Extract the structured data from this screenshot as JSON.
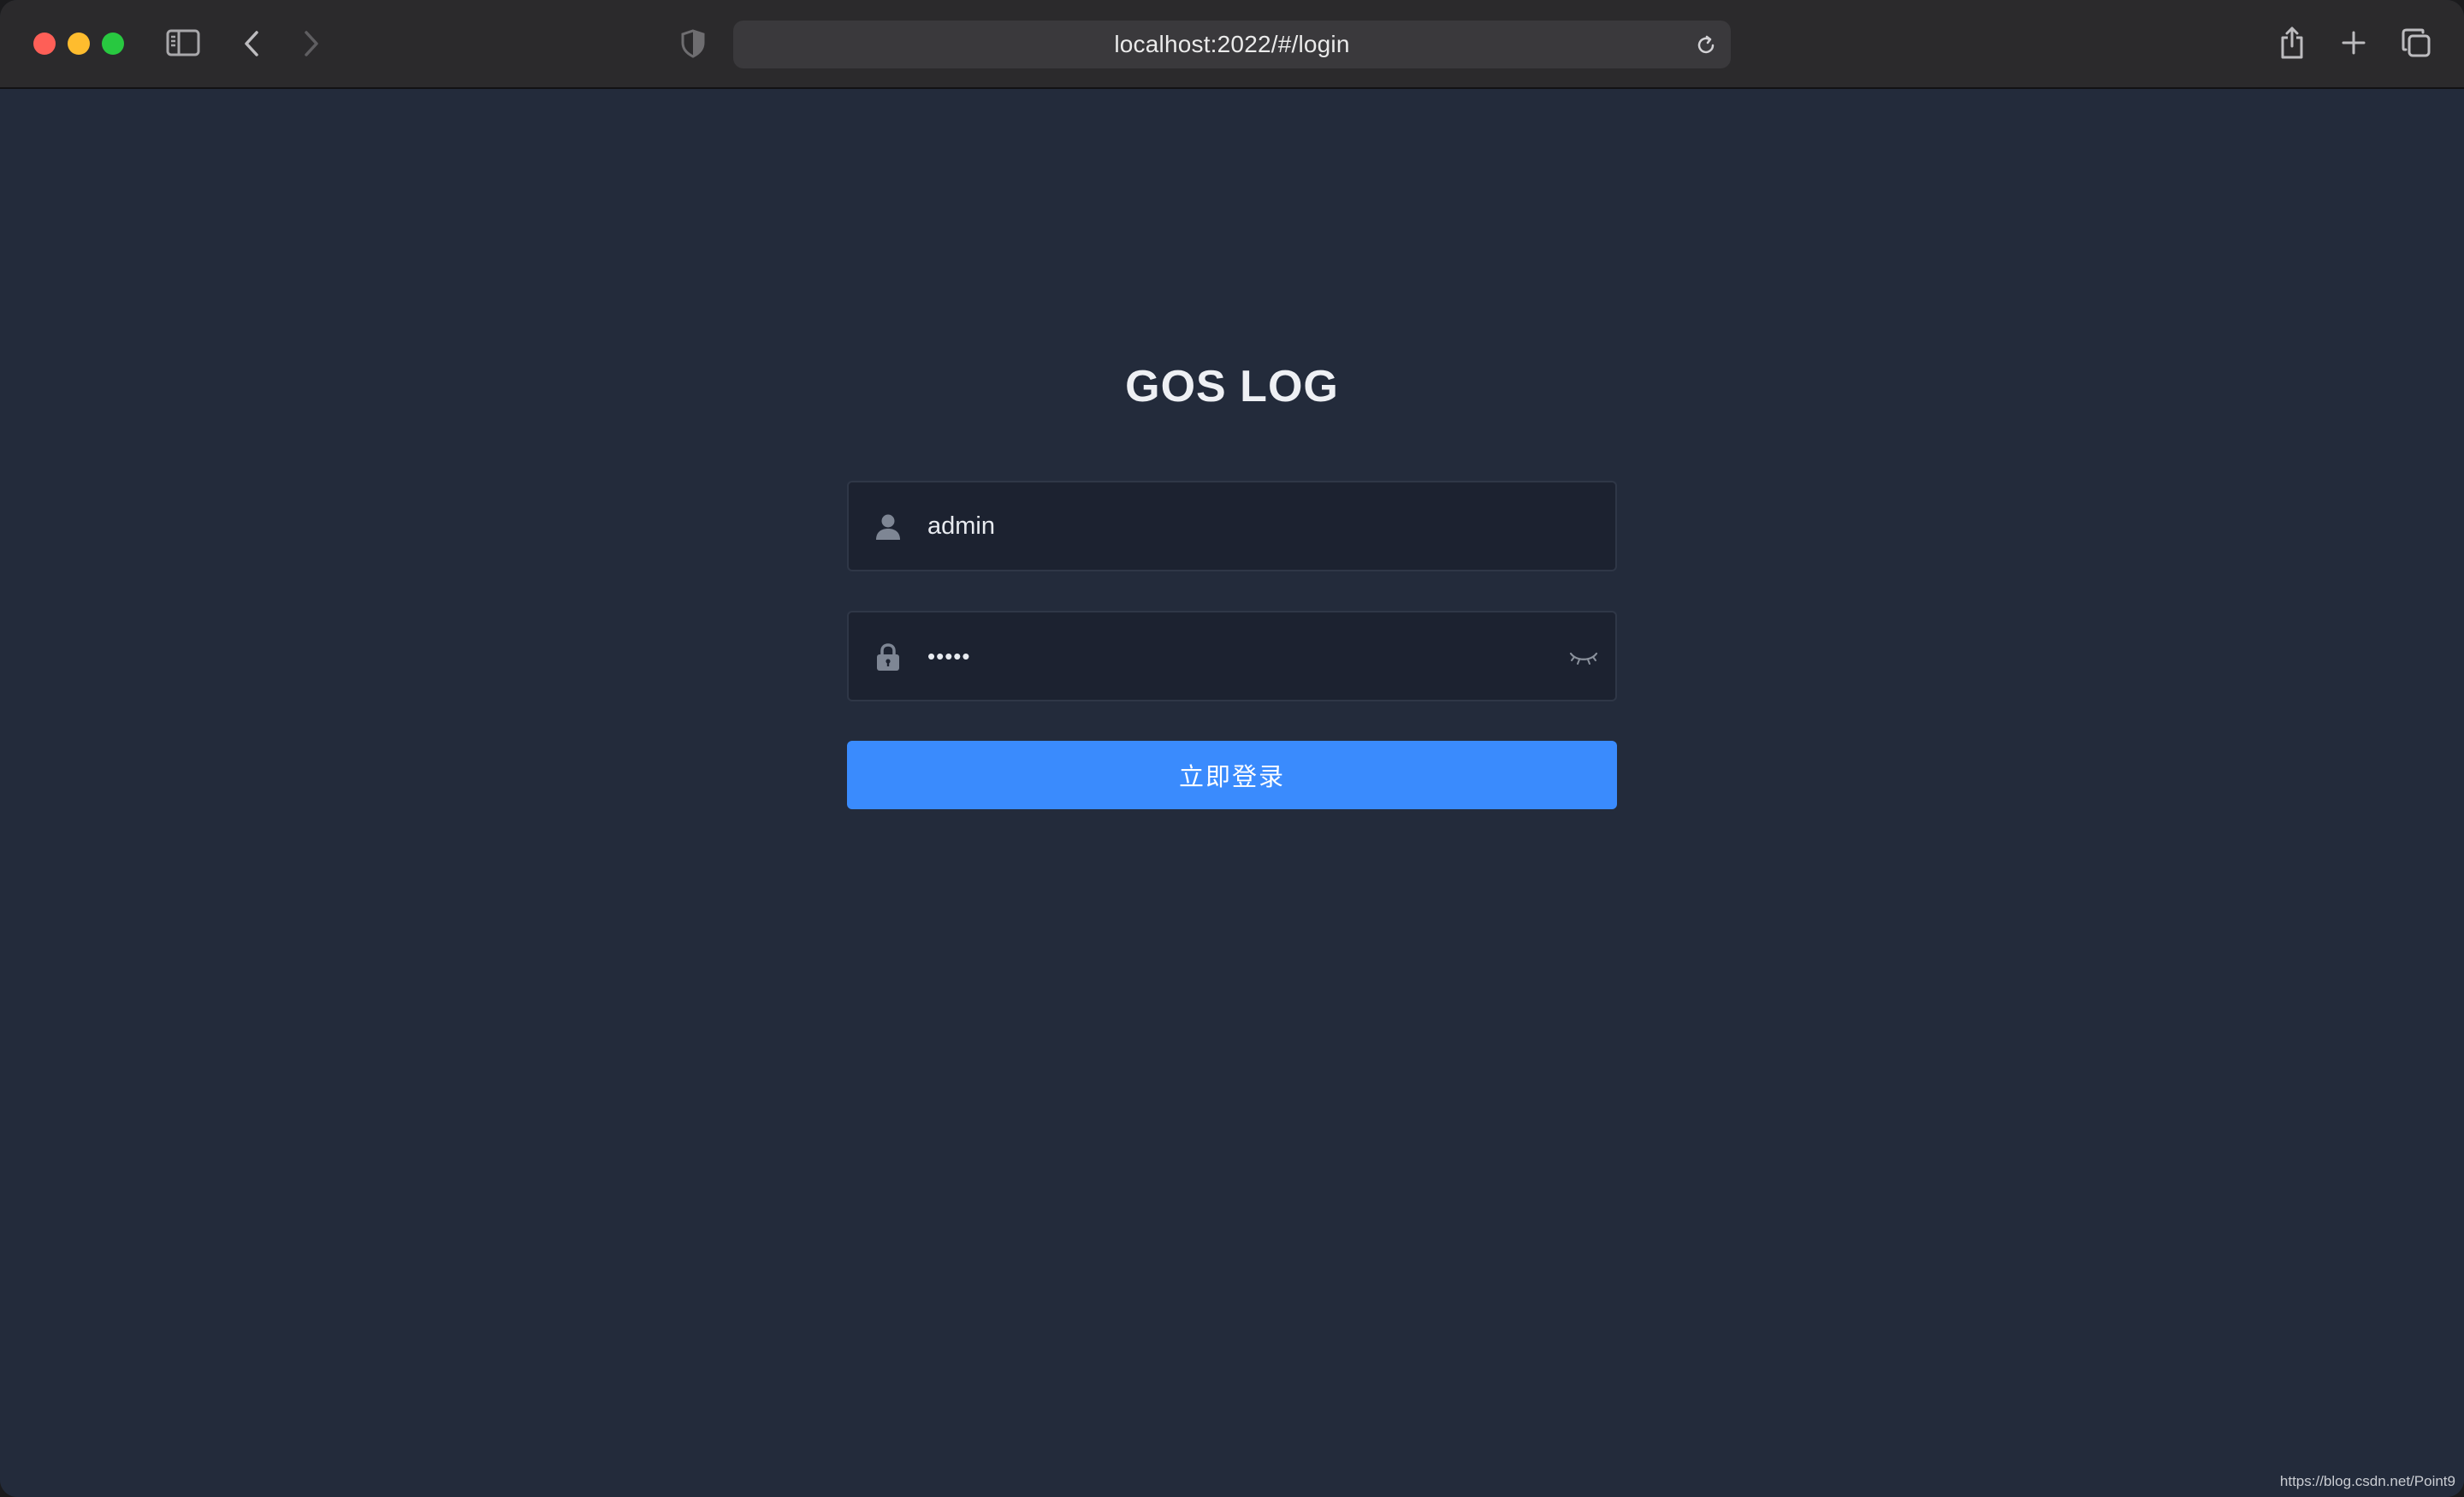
{
  "browser": {
    "url": "localhost:2022/#/login",
    "traffic_colors": {
      "close": "#fe5f57",
      "minimize": "#febc2e",
      "zoom": "#28c840"
    },
    "icons": {
      "sidebar": "sidebar-icon",
      "back": "chevron-left-icon",
      "forward": "chevron-right-icon",
      "privacy": "shield-icon",
      "reload": "reload-icon",
      "share": "share-icon",
      "new_tab": "plus-icon",
      "tabs": "tab-overview-icon"
    }
  },
  "login": {
    "title": "GOS LOG",
    "username_value": "admin",
    "password_value": "•••••",
    "submit_label": "立即登录",
    "accent_color": "#3a8bfd",
    "background_color": "#232b3b",
    "icons": {
      "username": "user-icon",
      "password": "lock-icon",
      "toggle_password": "eye-closed-icon"
    }
  },
  "watermark": "https://blog.csdn.net/Point9"
}
